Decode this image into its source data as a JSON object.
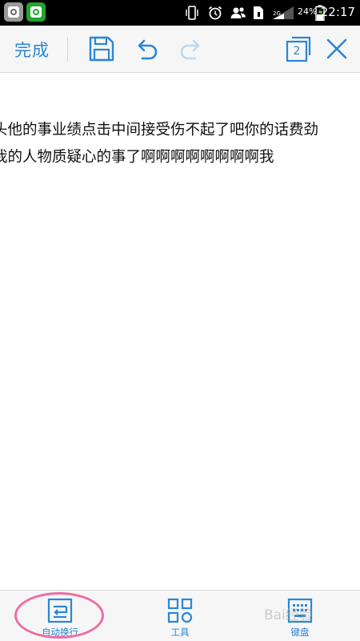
{
  "status_bar": {
    "network": "2G",
    "battery": "24%",
    "time": "22:17"
  },
  "toolbar": {
    "done_label": "完成",
    "page_count": "2"
  },
  "editor": {
    "lines": [
      "头他的事业绩点击中间接受伤不起了吧你的话费劲",
      "我的人物质疑心的事了啊啊啊啊啊啊啊啊我"
    ]
  },
  "bottom_bar": {
    "items": [
      {
        "label": "自动换行"
      },
      {
        "label": "工具"
      },
      {
        "label": "键盘"
      }
    ]
  },
  "watermark": "Bai经验",
  "colors": {
    "accent": "#2a86d6",
    "highlight": "#ee6ea4",
    "toolbar_bg": "#f6f6f6"
  }
}
